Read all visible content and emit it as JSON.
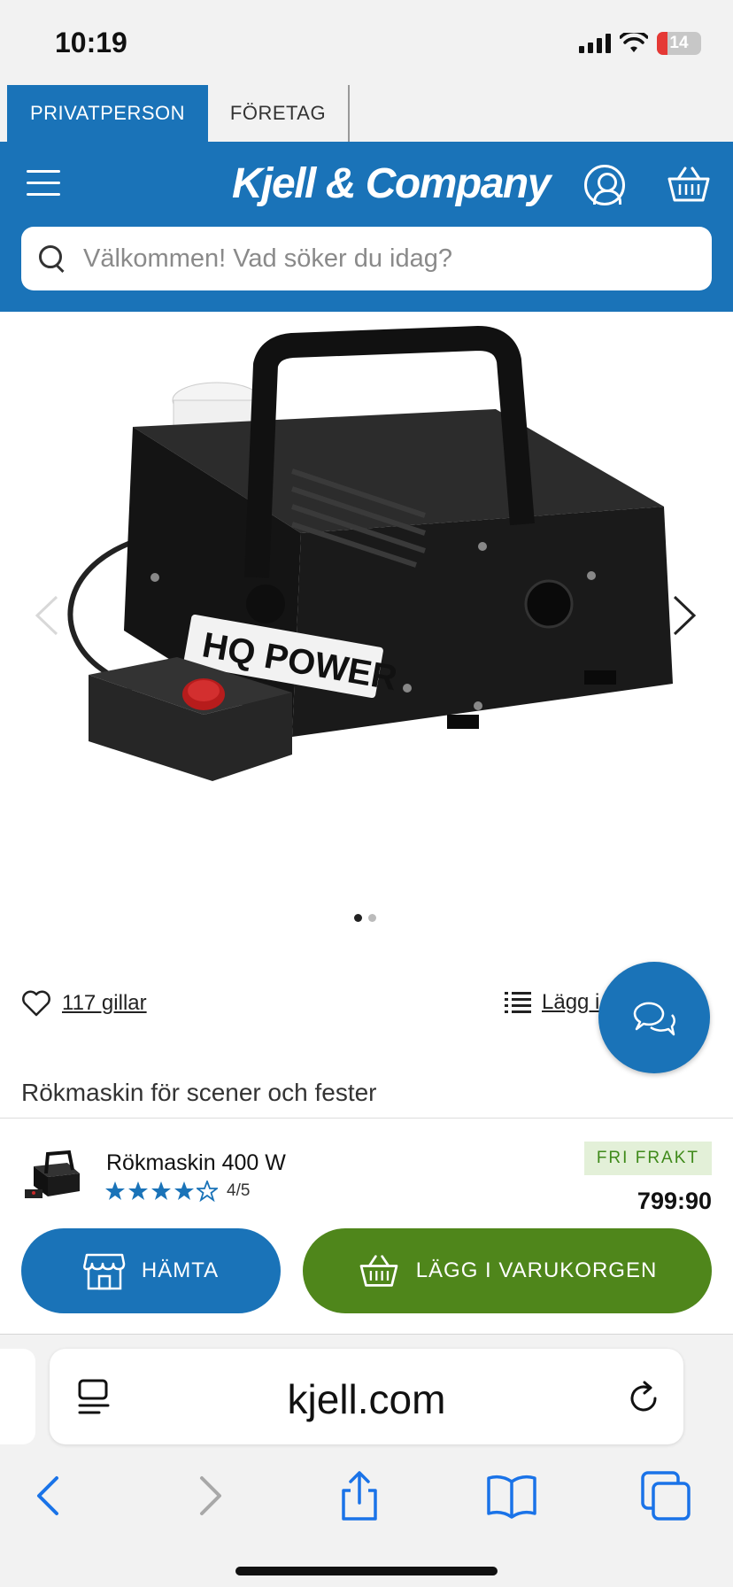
{
  "status_bar": {
    "time": "10:19",
    "battery": "14"
  },
  "segments": {
    "private": "PRIVATPERSON",
    "business": "FÖRETAG"
  },
  "header": {
    "logo": "Kjell & Company"
  },
  "search": {
    "placeholder": "Välkommen! Vad söker du idag?"
  },
  "gallery": {
    "image_alt": "Rökmaskin 400 W",
    "brand_label": "HQ POWER"
  },
  "actions": {
    "likes": "117 gillar",
    "add_to_list": "Lägg i"
  },
  "product": {
    "description": "Rökmaskin för scener och fester",
    "name": "Rökmaskin 400 W",
    "rating": "4/5",
    "badge": "FRI FRAKT",
    "price": "799:90"
  },
  "buttons": {
    "pickup": "HÄMTA",
    "add_to_cart": "LÄGG I VARUKORGEN"
  },
  "browser": {
    "url": "kjell.com"
  },
  "colors": {
    "brand_blue": "#1a73b8",
    "cart_green": "#4f861b",
    "badge_green": "#3f8a1a"
  }
}
